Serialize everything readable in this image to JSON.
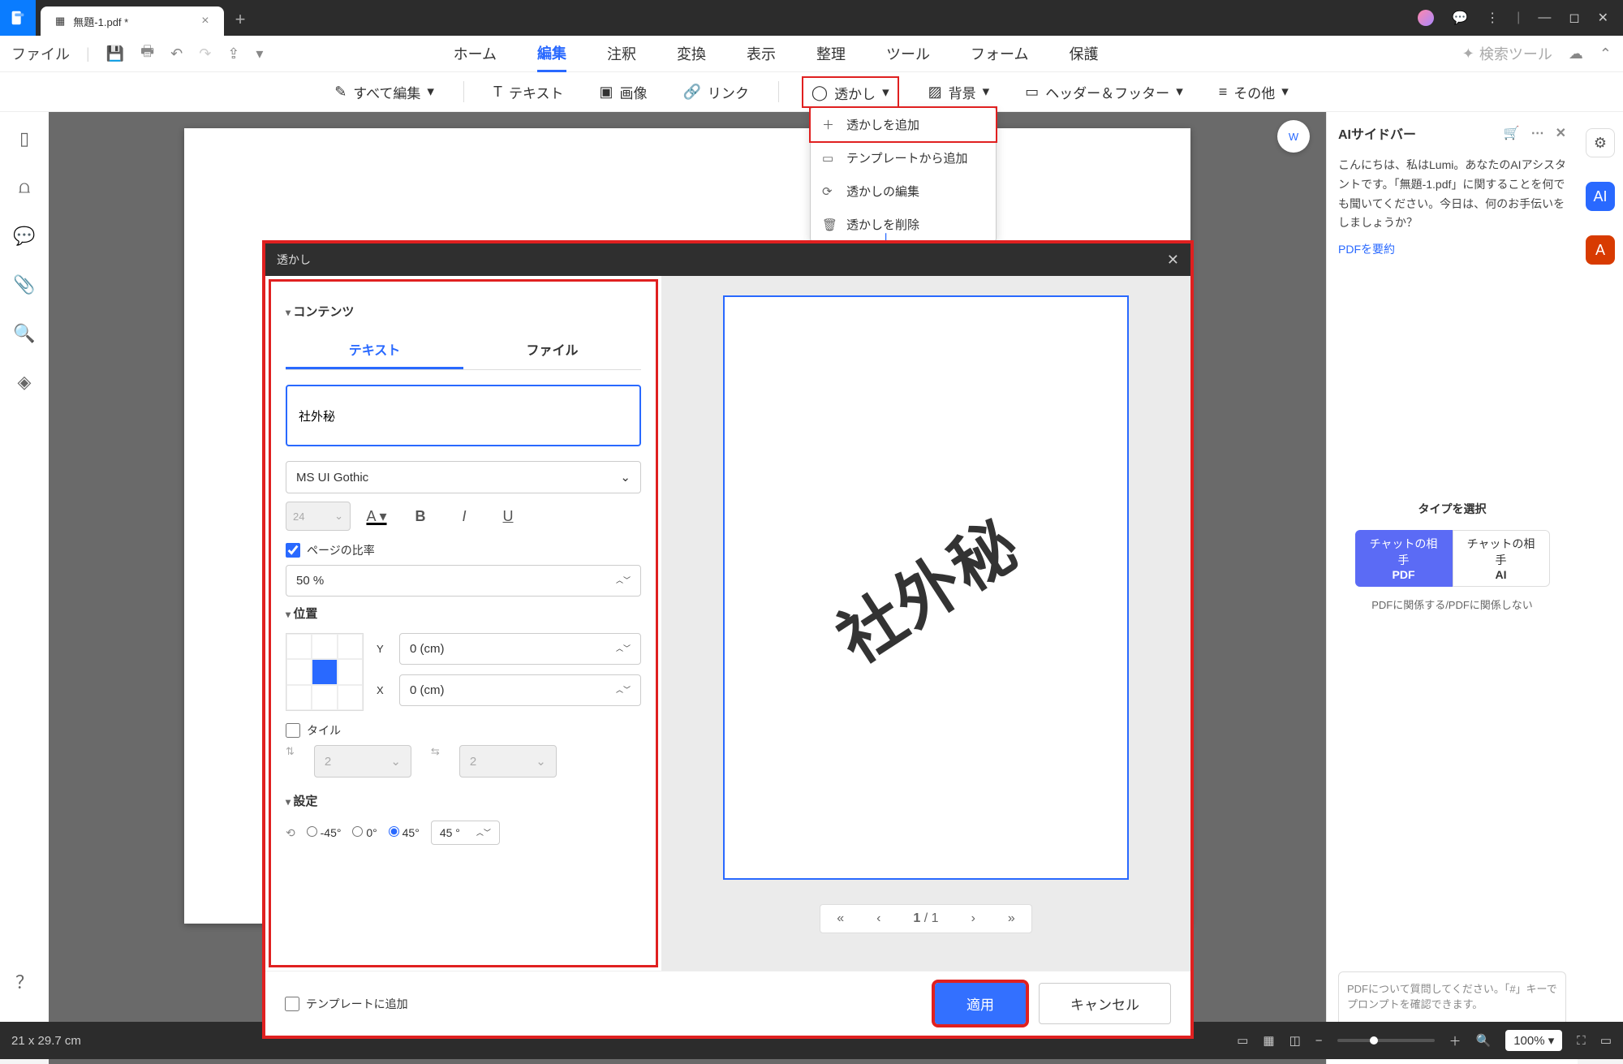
{
  "titlebar": {
    "tab_title": "無題-1.pdf *"
  },
  "file_menu": "ファイル",
  "tabs": [
    "ホーム",
    "編集",
    "注釈",
    "変換",
    "表示",
    "整理",
    "ツール",
    "フォーム",
    "保護"
  ],
  "tabs_active_index": 1,
  "search_placeholder": "検索ツール",
  "toolbar": {
    "edit_all": "すべて編集",
    "text": "テキスト",
    "image": "画像",
    "link": "リンク",
    "watermark": "透かし",
    "background": "背景",
    "header_footer": "ヘッダー＆フッター",
    "more": "その他"
  },
  "wm_menu": {
    "add": "透かしを追加",
    "from_template": "テンプレートから追加",
    "edit": "透かしの編集",
    "delete": "透かしを削除"
  },
  "dialog": {
    "title": "透かし",
    "section_content": "コンテンツ",
    "tab_text": "テキスト",
    "tab_file": "ファイル",
    "text_value": "社外秘",
    "font": "MS UI Gothic",
    "font_size": "24",
    "scale_label": "ページの比率",
    "scale_value": "50 %",
    "section_position": "位置",
    "y_label": "Y",
    "y_value": "0 (cm)",
    "x_label": "X",
    "x_value": "0 (cm)",
    "tile_label": "タイル",
    "tile_v": "2",
    "tile_h": "2",
    "section_settings": "設定",
    "rot_m45": "-45°",
    "rot_0": "0°",
    "rot_45": "45°",
    "rot_value": "45 °",
    "save_template": "テンプレートに追加",
    "apply": "適用",
    "cancel": "キャンセル",
    "page_current": "1",
    "page_total": "/ 1"
  },
  "ai": {
    "title": "AIサイドバー",
    "greeting": "こんにちは、私はLumi。あなたのAIアシスタントです。「無題-1.pdf」に関することを何でも聞いてください。今日は、何のお手伝いをしましょうか？",
    "link": "PDFを要約",
    "choose": "タイプを選択",
    "pill_a_1": "チャットの相手",
    "pill_a_2": "PDF",
    "pill_b_1": "チャットの相手",
    "pill_b_2": "AI",
    "sub": "PDFに関係する/PDFに関係しない",
    "placeholder": "PDFについて質問してください。「#」キーでプロンプトを確認できます。",
    "badge_pdf": "PDF",
    "badge_ai": "AI"
  },
  "status": {
    "dim": "21 x 29.7 cm",
    "zoom": "100%"
  }
}
